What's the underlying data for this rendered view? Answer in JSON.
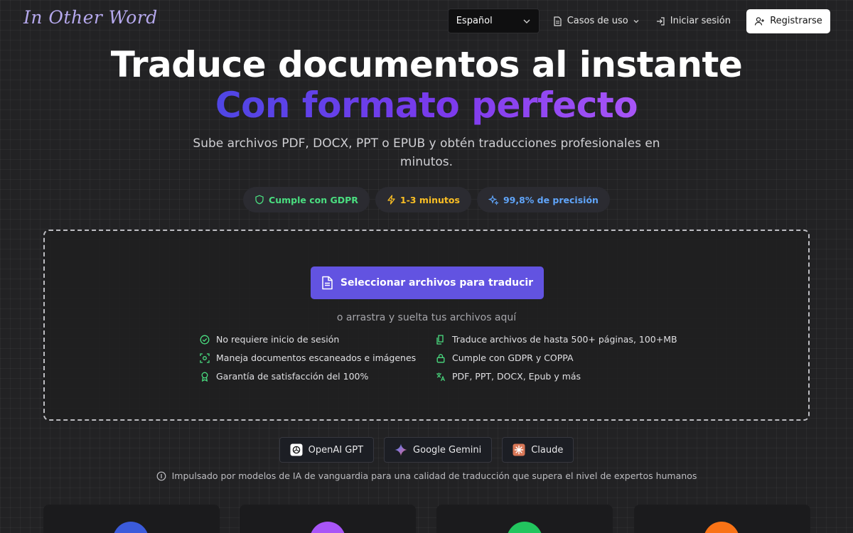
{
  "header": {
    "logo": "In Other Word",
    "language": "Español",
    "use_cases": "Casos de uso",
    "login": "Iniciar sesión",
    "register": "Registrarse"
  },
  "hero": {
    "title_line1": "Traduce documentos al instante",
    "title_line2": "Con formato perfecto",
    "subtitle": "Sube archivos PDF, DOCX, PPT o EPUB y obtén traducciones profesionales en minutos."
  },
  "badges": [
    {
      "label": "Cumple con GDPR",
      "color": "#4ade80",
      "icon": "shield-icon"
    },
    {
      "label": "1-3 minutos",
      "color": "#fbbf24",
      "icon": "lightning-icon"
    },
    {
      "label": "99,8% de precisión",
      "color": "#60a5fa",
      "icon": "sparkle-icon"
    }
  ],
  "dropzone": {
    "button": "Seleccionar archivos para traducir",
    "drag_text": "o arrastra y suelta tus archivos aquí",
    "features": [
      {
        "label": "No requiere inicio de sesión",
        "icon": "check-circle-icon"
      },
      {
        "label": "Traduce archivos de hasta 500+ páginas, 100+MB",
        "icon": "files-icon"
      },
      {
        "label": "Maneja documentos escaneados e imágenes",
        "icon": "scan-icon"
      },
      {
        "label": "Cumple con GDPR y COPPA",
        "icon": "lock-icon"
      },
      {
        "label": "Garantía de satisfacción del 100%",
        "icon": "award-icon"
      },
      {
        "label": "PDF, PPT, DOCX, Epub y más",
        "icon": "translate-icon"
      }
    ]
  },
  "models": [
    {
      "label": "OpenAI GPT",
      "icon": "openai-icon"
    },
    {
      "label": "Google Gemini",
      "icon": "gemini-icon"
    },
    {
      "label": "Claude",
      "icon": "claude-icon"
    }
  ],
  "powered_by": "Impulsado por modelos de IA de vanguardia para una calidad de traducción que supera el nivel de expertos humanos",
  "colors": {
    "accent": "#6253e1",
    "feature_icon": "#4ade80",
    "card_circles": [
      "#3b5bdb",
      "#a855f7",
      "#22c55e",
      "#f97316"
    ]
  }
}
